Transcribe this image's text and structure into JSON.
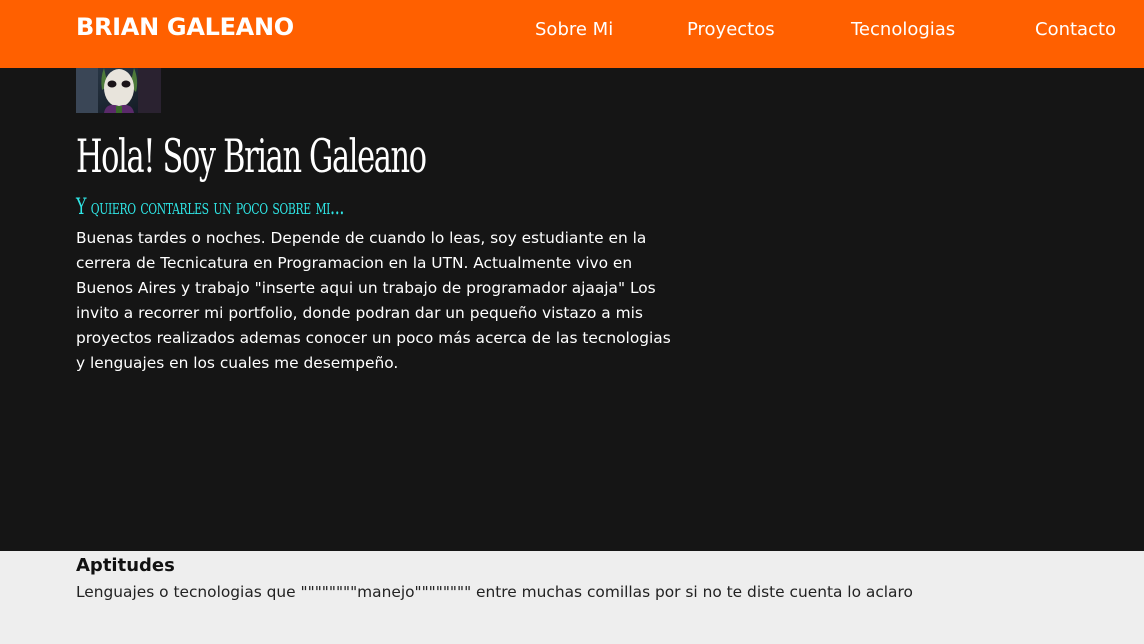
{
  "navbar": {
    "brand": "BRIAN GALEANO",
    "links": [
      "Sobre Mi",
      "Proyectos",
      "Tecnologias",
      "Contacto"
    ]
  },
  "hero": {
    "avatar_icon": "joker-profile-picture",
    "title": "Hola! Soy Brian Galeano",
    "subtitle": "Y quiero contarles un poco sobre mi...",
    "paragraph": "Buenas tardes o noches. Depende de cuando lo leas, soy estudiante en la cerrera de Tecnicatura en Programacion en la UTN. Actualmente vivo en Buenos Aires y trabajo \"inserte aqui un trabajo de programador ajaaja\" Los invito a recorrer mi portfolio, donde podran dar un pequeño vistazo a mis proyectos realizados ademas conocer un poco más acerca de las tecnologias y lenguajes en los cuales me desempeño."
  },
  "skills": {
    "title": "Aptitudes",
    "description": "Lenguajes o tecnologias que \"\"\"\"\"\"\"\"manejo\"\"\"\"\"\"\"\" entre muchas comillas por si no te diste cuenta lo aclaro"
  },
  "colors": {
    "navbar_bg": "#ff6000",
    "hero_bg": "#151515",
    "subtitle": "#2fe6e6",
    "skills_bg": "#eeeeee"
  }
}
